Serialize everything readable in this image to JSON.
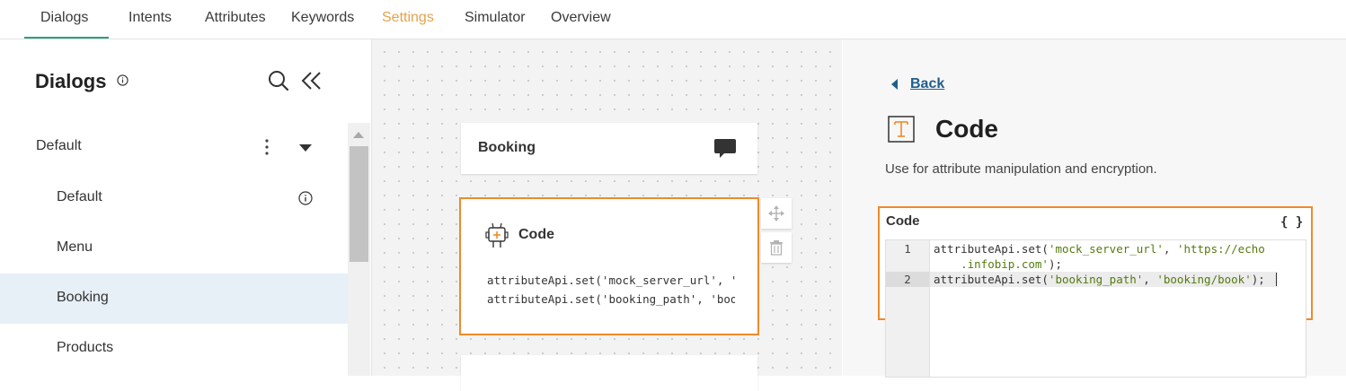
{
  "nav": {
    "tabs": [
      {
        "label": "Dialogs"
      },
      {
        "label": "Intents"
      },
      {
        "label": "Attributes"
      },
      {
        "label": "Keywords"
      },
      {
        "label": "Settings"
      },
      {
        "label": "Simulator"
      },
      {
        "label": "Overview"
      }
    ],
    "active_tab": "Dialogs",
    "highlight_color": "#e8a24a",
    "underline_color": "#2e9e7e"
  },
  "sidebar": {
    "title": "Dialogs",
    "tree": [
      {
        "label": "Default",
        "type": "group"
      },
      {
        "label": "Default",
        "type": "item"
      },
      {
        "label": "Menu",
        "type": "item"
      },
      {
        "label": "Booking",
        "type": "item",
        "selected": true
      },
      {
        "label": "Products",
        "type": "item"
      }
    ]
  },
  "canvas": {
    "booking_card": {
      "label": "Booking"
    },
    "code_card": {
      "label": "Code",
      "preview": [
        "attributeApi.set('mock_server_url', 'https://echo",
        "attributeApi.set('booking_path', 'booking/book');"
      ]
    }
  },
  "panel": {
    "back_label": "Back",
    "title": "Code",
    "description": "Use for attribute manipulation and encryption.",
    "code_label": "Code",
    "braces_label": "{ }",
    "editor": {
      "lines": [
        {
          "number": "1",
          "prefix": "attributeApi.set(",
          "arg1": "'mock_server_url'",
          "sep": ", ",
          "arg2": "'https://echo",
          "wrap": "    .infobip.com'",
          "suffix": ");"
        },
        {
          "number": "2",
          "prefix": "attributeApi.set(",
          "arg1": "'booking_path'",
          "sep": ", ",
          "arg2": "'booking/book'",
          "suffix": ");"
        }
      ]
    },
    "accent_color": "#ee8a2a"
  }
}
